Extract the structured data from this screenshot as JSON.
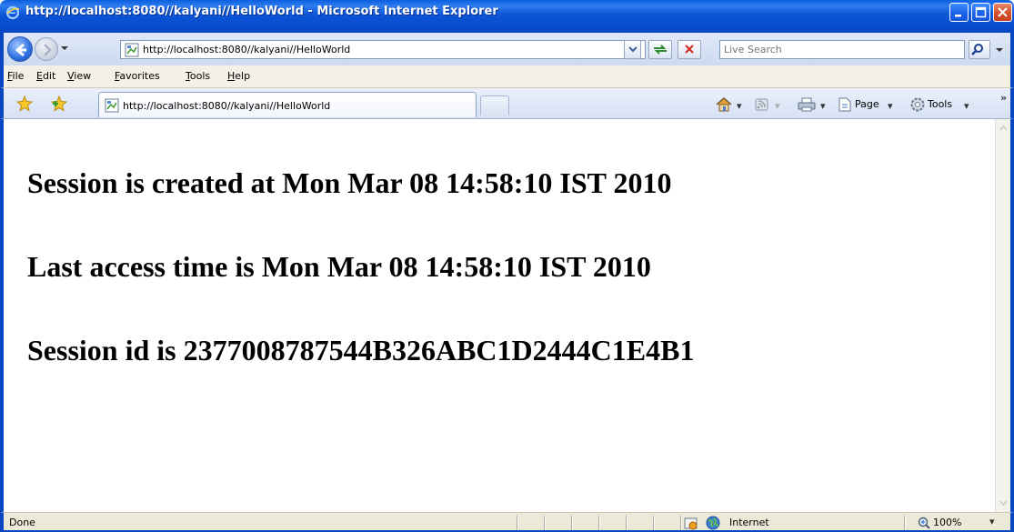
{
  "window": {
    "title": "http://localhost:8080//kalyani//HelloWorld - Microsoft Internet Explorer",
    "accent": "#0947c2"
  },
  "address_bar": {
    "url": "http://localhost:8080//kalyani//HelloWorld"
  },
  "search": {
    "placeholder": "Live Search"
  },
  "menu": {
    "items": [
      "File",
      "Edit",
      "View",
      "Favorites",
      "Tools",
      "Help"
    ]
  },
  "tab": {
    "title": "http://localhost:8080//kalyani//HelloWorld"
  },
  "command_bar": {
    "page_label": "Page",
    "tools_label": "Tools"
  },
  "page": {
    "lines": [
      "Session is created at Mon Mar 08 14:58:10 IST 2010",
      "Last access time is Mon Mar 08 14:58:10 IST 2010",
      "Session id is 2377008787544B326ABC1D2444C1E4B1"
    ]
  },
  "status_bar": {
    "status": "Done",
    "zone": "Internet",
    "zoom": "100%"
  },
  "icons": {
    "title": "ie-logo-icon",
    "back": "back-arrow-icon",
    "forward": "forward-arrow-icon",
    "refresh": "refresh-icon",
    "stop": "stop-icon",
    "search": "search-icon",
    "favorites": "favorites-star-icon",
    "add_favorite": "add-favorite-icon",
    "home": "home-icon",
    "feeds": "feeds-icon",
    "print": "print-icon",
    "page": "page-icon",
    "tools": "gear-icon",
    "globe": "globe-icon",
    "zoom": "zoom-icon"
  }
}
